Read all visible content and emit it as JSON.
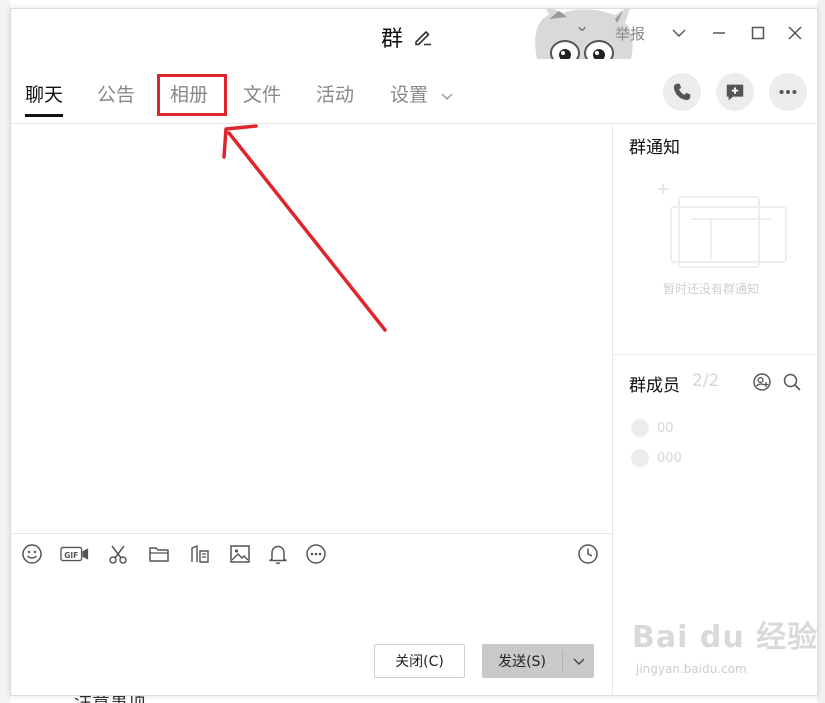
{
  "window": {
    "title": "群",
    "report": "举报"
  },
  "tabs": [
    {
      "label": "聊天",
      "active": true
    },
    {
      "label": "公告",
      "active": false
    },
    {
      "label": "相册",
      "active": false
    },
    {
      "label": "文件",
      "active": false
    },
    {
      "label": "活动",
      "active": false
    },
    {
      "label": "设置",
      "active": false
    }
  ],
  "toolbar_icons": [
    "emoji-icon",
    "gif-icon",
    "scissors-icon",
    "folder-icon",
    "rich-text-icon",
    "image-icon",
    "bell-icon",
    "more-circle-icon",
    "clock-icon"
  ],
  "buttons": {
    "close": "关闭(C)",
    "send": "发送(S)"
  },
  "sidebar": {
    "notice_title": "群通知",
    "notice_empty": "暂时还没有群通知",
    "members_title": "群成员",
    "members_count": "2/2",
    "members": [
      {
        "name": "00"
      },
      {
        "name": "000"
      }
    ]
  },
  "background": {
    "bottom_text": "注意事项"
  },
  "watermark": {
    "main": "Bai du 经验",
    "sub": "jingyan.baidu.com"
  },
  "colors": {
    "highlight": "#e0242b",
    "send_button": "#c9c9c9"
  }
}
